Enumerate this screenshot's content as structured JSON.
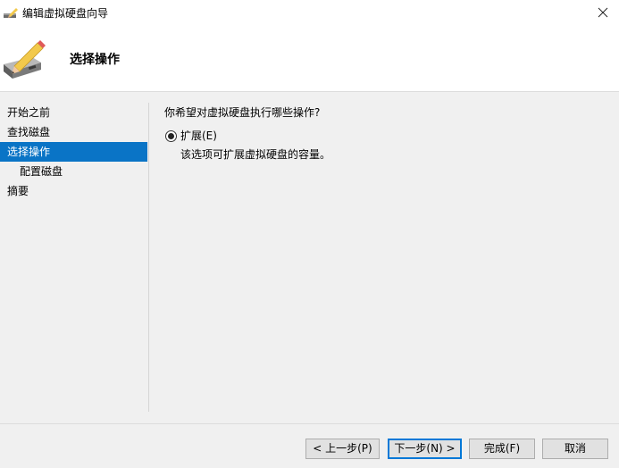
{
  "window": {
    "title": "编辑虚拟硬盘向导",
    "close_icon": "close-icon"
  },
  "header": {
    "title": "选择操作",
    "icon": "disk-edit-icon"
  },
  "nav": {
    "items": [
      {
        "label": "开始之前",
        "selected": false,
        "indent": false
      },
      {
        "label": "查找磁盘",
        "selected": false,
        "indent": false
      },
      {
        "label": "选择操作",
        "selected": true,
        "indent": false
      },
      {
        "label": "配置磁盘",
        "selected": false,
        "indent": true
      },
      {
        "label": "摘要",
        "selected": false,
        "indent": false
      }
    ]
  },
  "main": {
    "question": "你希望对虚拟硬盘执行哪些操作?",
    "options": [
      {
        "label": "扩展(E)",
        "description": "该选项可扩展虚拟硬盘的容量。",
        "checked": true
      }
    ]
  },
  "buttons": {
    "prev": "< 上一步(P)",
    "next": "下一步(N) >",
    "finish": "完成(F)",
    "cancel": "取消"
  },
  "colors": {
    "selected_nav_bg": "#0a74c6",
    "default_button_border": "#0078d7"
  }
}
